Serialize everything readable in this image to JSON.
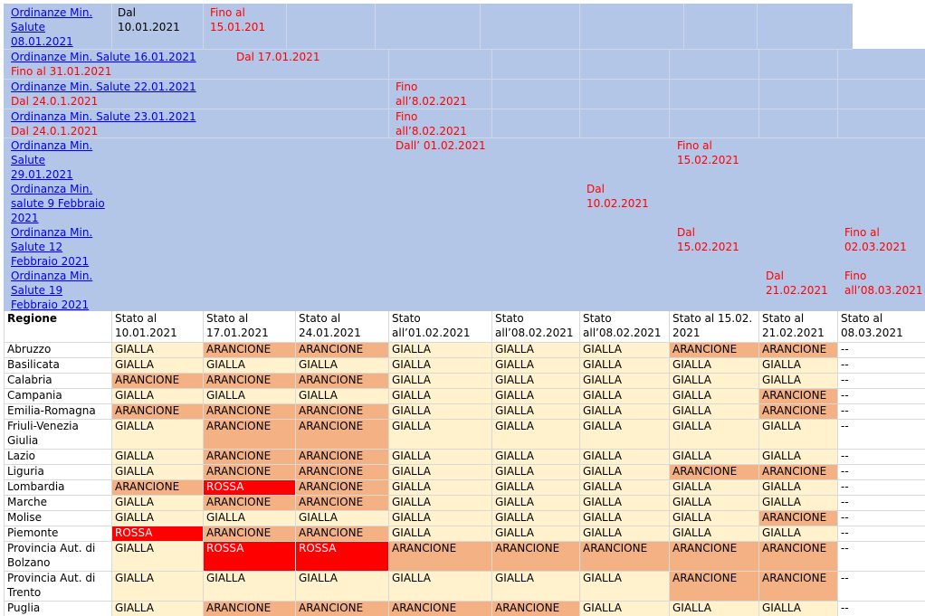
{
  "orders": {
    "r1": {
      "link": "Ordinanze Min. Salute 08.01.2021",
      "c1": "Dal 10.01.2021",
      "c2": "Fino al 15.01.201"
    },
    "r2": {
      "link": "Ordinanze Min. Salute 16.01.2021",
      "sub": "Fino al 31.01.2021",
      "c2": "Dal 17.01.2021"
    },
    "r3": {
      "link": "Ordinanze Min. Salute 22.01.2021",
      "sub": "Dal 24.0.1.2021",
      "c4": "Fino all’8.02.2021"
    },
    "r4": {
      "link": "Ordinanza Min. Salute 23.01.2021",
      "sub": "Dal 24.0.1.2021",
      "c4": "Fino all’8.02.2021"
    },
    "r5": {
      "link": "Ordinanza Min. Salute 29.01.2021",
      "c4": "Dall’ 01.02.2021",
      "c7": "Fino al 15.02.2021"
    },
    "r6": {
      "link": "Ordinanza Min. salute 9 Febbraio 2021",
      "c6": "Dal 10.02.2021"
    },
    "r7": {
      "link": "Ordinanza Min. Salute 12 Febbraio 2021",
      "c7": "Dal 15.02.2021",
      "c9": "Fino al 02.03.2021"
    },
    "r8": {
      "link": "Ordinanza Min. Salute 19 Febbraio 2021",
      "c8": "Dal 21.02.2021",
      "c9": "Fino all’08.03.2021"
    }
  },
  "table": {
    "headers": [
      "Regione",
      "Stato al 10.01.2021",
      "Stato al 17.01.2021",
      "Stato al 24.01.2021",
      "Stato all’01.02.2021",
      "Stato all’08.02.2021",
      "Stato all’08.02.2021",
      "Stato al 15.02. 2021",
      "Stato al 21.02.2021",
      "Stato al 08.03.2021"
    ],
    "rows": [
      {
        "region": "Abruzzo",
        "values": [
          "GIALLA",
          "ARANCIONE",
          "ARANCIONE",
          "GIALLA",
          "GIALLA",
          "GIALLA",
          "ARANCIONE",
          "ARANCIONE",
          "--"
        ]
      },
      {
        "region": "Basilicata",
        "values": [
          "GIALLA",
          "GIALLA",
          "GIALLA",
          "GIALLA",
          "GIALLA",
          "GIALLA",
          "GIALLA",
          "GIALLA",
          "--"
        ]
      },
      {
        "region": "Calabria",
        "values": [
          "ARANCIONE",
          "ARANCIONE",
          "ARANCIONE",
          "GIALLA",
          "GIALLA",
          "GIALLA",
          "GIALLA",
          "GIALLA",
          "--"
        ]
      },
      {
        "region": "Campania",
        "values": [
          "GIALLA",
          "GIALLA",
          "GIALLA",
          "GIALLA",
          "GIALLA",
          "GIALLA",
          "GIALLA",
          "ARANCIONE",
          "--"
        ]
      },
      {
        "region": "Emilia-Romagna",
        "values": [
          "ARANCIONE",
          "ARANCIONE",
          "ARANCIONE",
          "GIALLA",
          "GIALLA",
          "GIALLA",
          "GIALLA",
          "ARANCIONE",
          "--"
        ]
      },
      {
        "region": "Friuli-Venezia Giulia",
        "values": [
          "GIALLA",
          "ARANCIONE",
          "ARANCIONE",
          "GIALLA",
          "GIALLA",
          "GIALLA",
          "GIALLA",
          "GIALLA",
          "--"
        ]
      },
      {
        "region": "Lazio",
        "values": [
          "GIALLA",
          "ARANCIONE",
          "ARANCIONE",
          "GIALLA",
          "GIALLA",
          "GIALLA",
          "GIALLA",
          "GIALLA",
          "--"
        ]
      },
      {
        "region": "Liguria",
        "values": [
          "GIALLA",
          "ARANCIONE",
          "ARANCIONE",
          "GIALLA",
          "GIALLA",
          "GIALLA",
          "ARANCIONE",
          "ARANCIONE",
          "--"
        ]
      },
      {
        "region": "Lombardia",
        "values": [
          "ARANCIONE",
          "ROSSA",
          "ARANCIONE",
          "GIALLA",
          "GIALLA",
          "GIALLA",
          "GIALLA",
          "GIALLA",
          "--"
        ]
      },
      {
        "region": "Marche",
        "values": [
          "GIALLA",
          "ARANCIONE",
          "ARANCIONE",
          "GIALLA",
          "GIALLA",
          "GIALLA",
          "GIALLA",
          "GIALLA",
          "--"
        ]
      },
      {
        "region": "Molise",
        "values": [
          "GIALLA",
          "GIALLA",
          "GIALLA",
          "GIALLA",
          "GIALLA",
          "GIALLA",
          "GIALLA",
          "ARANCIONE",
          "--"
        ]
      },
      {
        "region": "Piemonte",
        "values": [
          "ROSSA",
          "ARANCIONE",
          "ARANCIONE",
          "GIALLA",
          "GIALLA",
          "GIALLA",
          "GIALLA",
          "GIALLA",
          "--"
        ]
      },
      {
        "region": "Provincia Aut. di Bolzano",
        "values": [
          "GIALLA",
          "ROSSA",
          "ROSSA",
          "ARANCIONE",
          "ARANCIONE",
          "ARANCIONE",
          "ARANCIONE",
          "ARANCIONE",
          "--"
        ]
      },
      {
        "region": "Provincia Aut. di Trento",
        "values": [
          "GIALLA",
          "GIALLA",
          "GIALLA",
          "GIALLA",
          "GIALLA",
          "GIALLA",
          "ARANCIONE",
          "ARANCIONE",
          "--"
        ]
      },
      {
        "region": "Puglia",
        "values": [
          "GIALLA",
          "ARANCIONE",
          "ARANCIONE",
          "ARANCIONE",
          "ARANCIONE",
          "GIALLA",
          "GIALLA",
          "GIALLA",
          "--"
        ]
      }
    ]
  },
  "colors": {
    "header_bg": "#b4c6e7",
    "gialla": "#fff2cc",
    "arancione": "#f4b183",
    "rossa": "#ff0000",
    "link": "#0000ee",
    "red_text": "#ff0000"
  }
}
